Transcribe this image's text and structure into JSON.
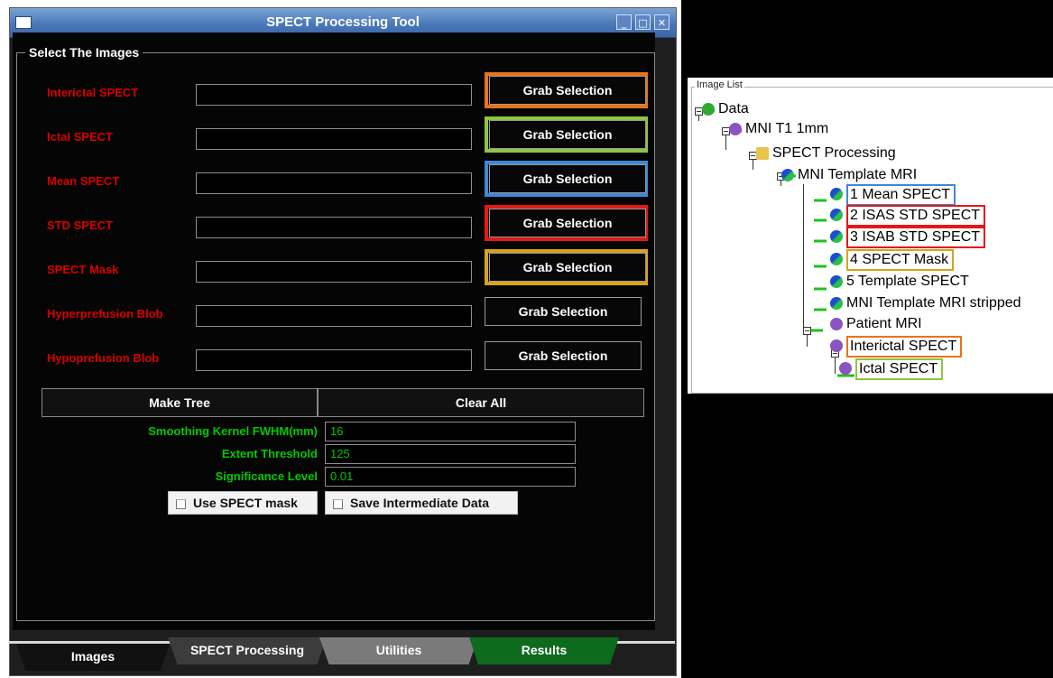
{
  "window": {
    "title": "SPECT Processing Tool",
    "minimize": "_",
    "maximize": "□",
    "close": "✕"
  },
  "group_title": "Select The Images",
  "image_rows": [
    {
      "label": "Interictal SPECT",
      "button": "Grab Selection",
      "highlight": "#e8731a"
    },
    {
      "label": "Ictal SPECT",
      "button": "Grab Selection",
      "highlight": "#8ec63f"
    },
    {
      "label": "Mean SPECT",
      "button": "Grab Selection",
      "highlight": "#3f87d8"
    },
    {
      "label": "STD SPECT",
      "button": "Grab Selection",
      "highlight": "#e31818"
    },
    {
      "label": "SPECT Mask",
      "button": "Grab Selection",
      "highlight": "#d9a21b"
    },
    {
      "label": "Hyperprefusion Blob",
      "button": "Grab Selection",
      "highlight": ""
    },
    {
      "label": "Hypoprefusion Blob",
      "button": "Grab Selection",
      "highlight": ""
    }
  ],
  "actions": {
    "make_tree": "Make Tree",
    "clear_all": "Clear All"
  },
  "params": [
    {
      "label": "Smoothing Kernel FWHM(mm)",
      "value": "16"
    },
    {
      "label": "Extent Threshold",
      "value": "125"
    },
    {
      "label": "Significance Level",
      "value": "0.01"
    }
  ],
  "checkboxes": {
    "use_mask": "Use SPECT mask",
    "save_intermediate": "Save Intermediate Data"
  },
  "tabs": [
    {
      "label": "Images",
      "color": "#111111"
    },
    {
      "label": "SPECT Processing",
      "color": "#3c3c3c"
    },
    {
      "label": "Utilities",
      "color": "#7a7a7a"
    },
    {
      "label": "Results",
      "color": "#0d6b1e"
    }
  ],
  "image_list": {
    "title": "Image List",
    "nodes": [
      {
        "label": "Data",
        "icon": "green-blob-icon"
      },
      {
        "label": "MNI T1 1mm",
        "icon": "purple-brain-icon"
      },
      {
        "label": "SPECT Processing",
        "icon": "folder-icon"
      },
      {
        "label": "MNI Template MRI",
        "icon": "blue-green-brain-icon"
      },
      {
        "label": "1 Mean SPECT",
        "icon": "blue-green-brain-icon",
        "highlight": "#3f87d8"
      },
      {
        "label": "2 ISAS STD SPECT",
        "icon": "blue-green-brain-icon",
        "highlight": "#e31818"
      },
      {
        "label": "3 ISAB STD SPECT",
        "icon": "blue-green-brain-icon",
        "highlight": "#e31818"
      },
      {
        "label": "4 SPECT Mask",
        "icon": "blue-green-brain-icon",
        "highlight": "#d9a21b"
      },
      {
        "label": "5 Template SPECT",
        "icon": "blue-green-brain-icon"
      },
      {
        "label": "MNI Template MRI stripped",
        "icon": "blue-green-brain-icon"
      },
      {
        "label": "Patient MRI",
        "icon": "purple-brain-icon"
      },
      {
        "label": "Interictal SPECT",
        "icon": "purple-brain-icon",
        "highlight": "#e8731a"
      },
      {
        "label": "Ictal SPECT",
        "icon": "purple-brain-icon",
        "highlight": "#8ec63f"
      }
    ]
  }
}
